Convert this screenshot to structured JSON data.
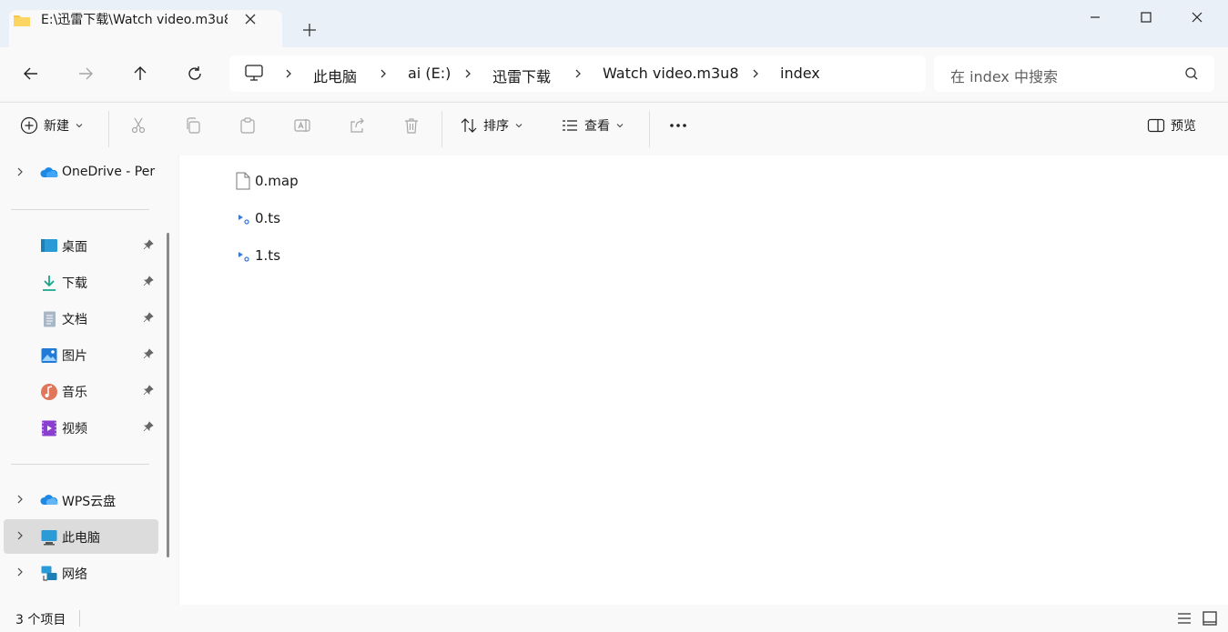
{
  "tab": {
    "title": "E:\\迅雷下载\\Watch video.m3u8"
  },
  "address": {
    "crumbs": [
      "此电脑",
      "ai (E:)",
      "迅雷下载",
      "Watch video.m3u8",
      "index"
    ]
  },
  "search": {
    "placeholder": "在 index 中搜索"
  },
  "toolbar": {
    "new_label": "新建",
    "sort_label": "排序",
    "view_label": "查看",
    "preview_label": "预览"
  },
  "sidebar": {
    "onedrive": "OneDrive - Per",
    "quick": [
      {
        "label": "桌面",
        "icon": "desktop-icon"
      },
      {
        "label": "下载",
        "icon": "download-icon"
      },
      {
        "label": "文档",
        "icon": "documents-icon"
      },
      {
        "label": "图片",
        "icon": "pictures-icon"
      },
      {
        "label": "音乐",
        "icon": "music-icon"
      },
      {
        "label": "视频",
        "icon": "videos-icon"
      }
    ],
    "wps": "WPS云盘",
    "thispc": "此电脑",
    "network": "网络"
  },
  "files": [
    {
      "name": "0.map",
      "icon": "file-icon"
    },
    {
      "name": "0.ts",
      "icon": "video-file-icon"
    },
    {
      "name": "1.ts",
      "icon": "video-file-icon"
    }
  ],
  "status": {
    "count": "3 个项目"
  },
  "colors": {
    "accent": "#0067c0",
    "selected": "#dcdcdc",
    "folder": "#f8c642"
  }
}
